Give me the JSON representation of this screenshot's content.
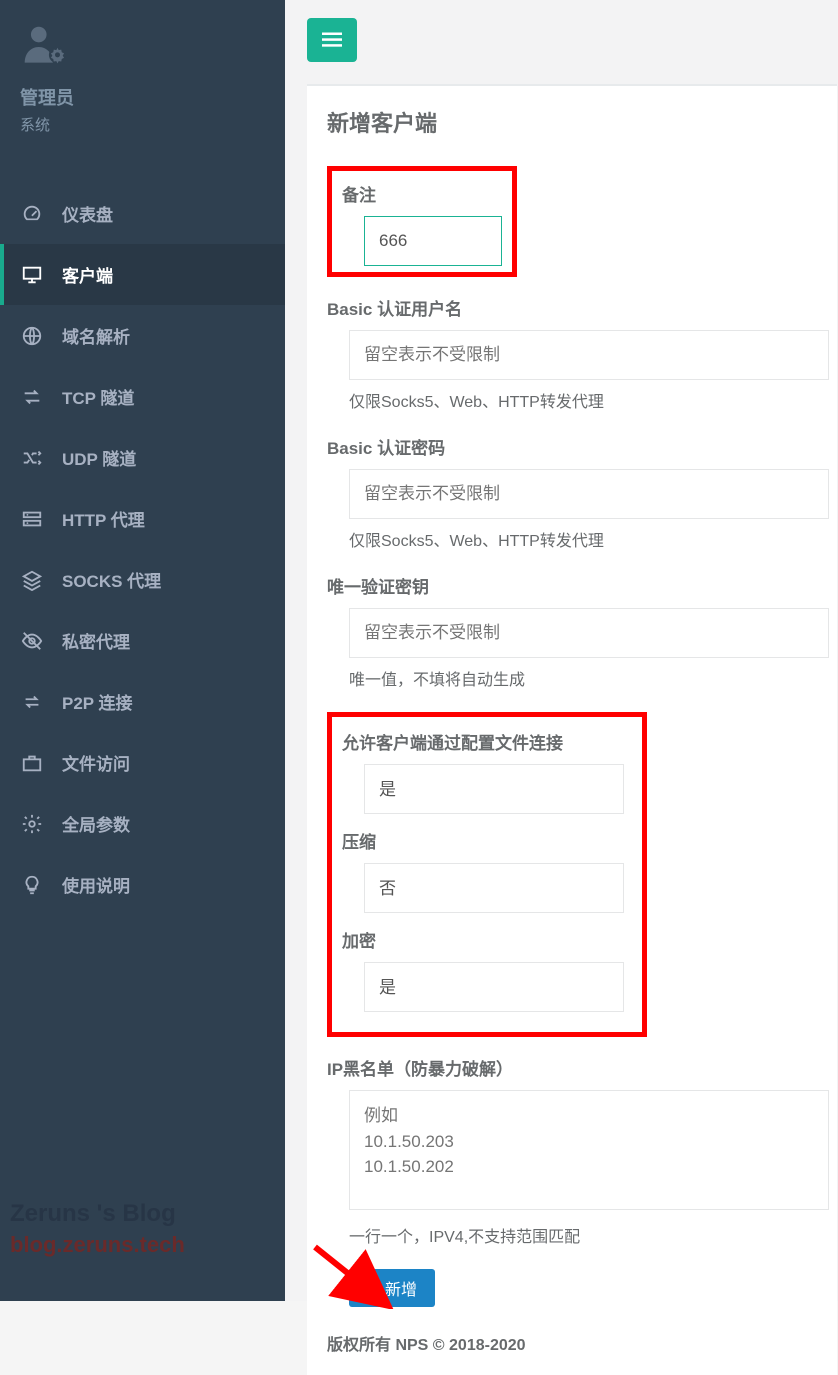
{
  "sidebar": {
    "user_name": "管理员",
    "user_sub": "系统",
    "items": [
      {
        "label": "仪表盘"
      },
      {
        "label": "客户端"
      },
      {
        "label": "域名解析"
      },
      {
        "label": "TCP 隧道"
      },
      {
        "label": "UDP 隧道"
      },
      {
        "label": "HTTP 代理"
      },
      {
        "label": "SOCKS 代理"
      },
      {
        "label": "私密代理"
      },
      {
        "label": "P2P 连接"
      },
      {
        "label": "文件访问"
      },
      {
        "label": "全局参数"
      },
      {
        "label": "使用说明"
      }
    ]
  },
  "watermark": {
    "line1": "Zeruns 's Blog",
    "line2": "blog.zeruns.tech"
  },
  "panel": {
    "title": "新增客户端",
    "remark_label": "备注",
    "remark_value": "666",
    "basic_user_label": "Basic 认证用户名",
    "basic_user_placeholder": "留空表示不受限制",
    "basic_user_help": "仅限Socks5、Web、HTTP转发代理",
    "basic_pass_label": "Basic 认证密码",
    "basic_pass_placeholder": "留空表示不受限制",
    "basic_pass_help": "仅限Socks5、Web、HTTP转发代理",
    "vkey_label": "唯一验证密钥",
    "vkey_placeholder": "留空表示不受限制",
    "vkey_help": "唯一值，不填将自动生成",
    "allow_conf_label": "允许客户端通过配置文件连接",
    "allow_conf_value": "是",
    "compress_label": "压缩",
    "compress_value": "否",
    "crypt_label": "加密",
    "crypt_value": "是",
    "blacklist_label": "IP黑名单（防暴力破解）",
    "blacklist_placeholder": "例如\n10.1.50.203\n10.1.50.202",
    "blacklist_help": "一行一个，IPV4,不支持范围匹配",
    "submit_label": "新增"
  },
  "footer": {
    "copyright": "版权所有 NPS © 2018-2020"
  }
}
